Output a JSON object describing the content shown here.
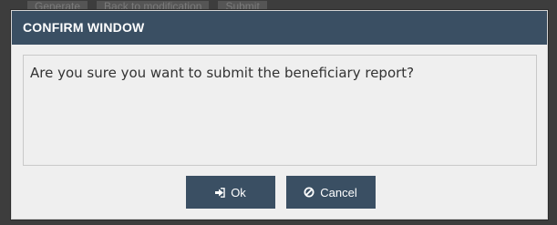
{
  "background": {
    "toolbar": [
      "Generate",
      "Back to modification",
      "Submit"
    ]
  },
  "dialog": {
    "title": "CONFIRM WINDOW",
    "message": "Are you sure you want to submit the beneficiary report?",
    "ok_label": "Ok",
    "ok_icon": "sign-in-icon",
    "cancel_label": "Cancel",
    "cancel_icon": "ban-icon"
  },
  "colors": {
    "header_bg": "#3a4f63",
    "button_bg": "#3a4f63",
    "dialog_bg": "#efefef",
    "overlay": "#3d3d3d"
  }
}
